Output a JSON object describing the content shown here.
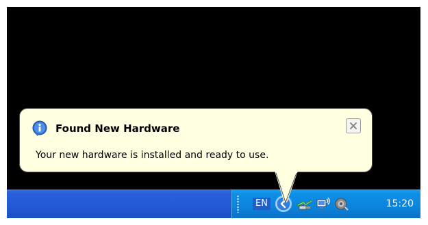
{
  "balloon": {
    "title": "Found New Hardware",
    "message": "Your new hardware is installed and ready to use.",
    "icon": "info-icon",
    "close_icon": "close-icon"
  },
  "taskbar": {
    "language": "EN",
    "clock": "15:20",
    "tray_icons": [
      "show-hidden-icons-icon",
      "safely-remove-hardware-icon",
      "network-icon",
      "volume-icon"
    ]
  },
  "colors": {
    "balloon_background": "#ffffe1",
    "taskbar_blue": "#245ad6",
    "tray_blue": "#0c84dc",
    "desktop": "#000000"
  }
}
